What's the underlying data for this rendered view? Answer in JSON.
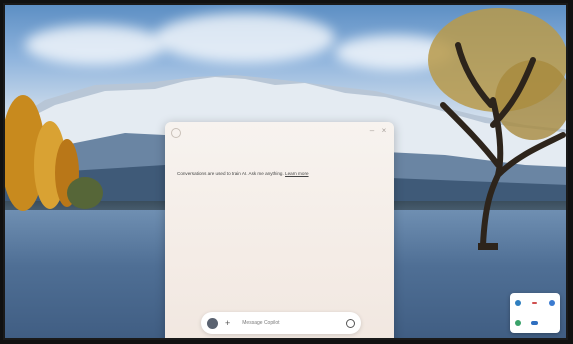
{
  "colors": {
    "panel_bg": "#f5eee8",
    "accent": "#2f7fbf"
  },
  "copilot": {
    "greeting": "Conversations are used to train AI. Ask me anything.",
    "greeting_link": "Learn more",
    "composer_placeholder": "Message Copilot",
    "icons": {
      "menu": "circle-menu-icon",
      "actions": [
        "minimize-icon",
        "close-icon"
      ],
      "avatar": "copilot-logo-icon",
      "add": "plus-icon",
      "mic": "microphone-icon"
    }
  },
  "tray": {
    "icons": [
      "copilot-icon",
      "close-icon",
      "settings-icon",
      "app-icon",
      "chat-icon",
      "empty-slot"
    ]
  }
}
